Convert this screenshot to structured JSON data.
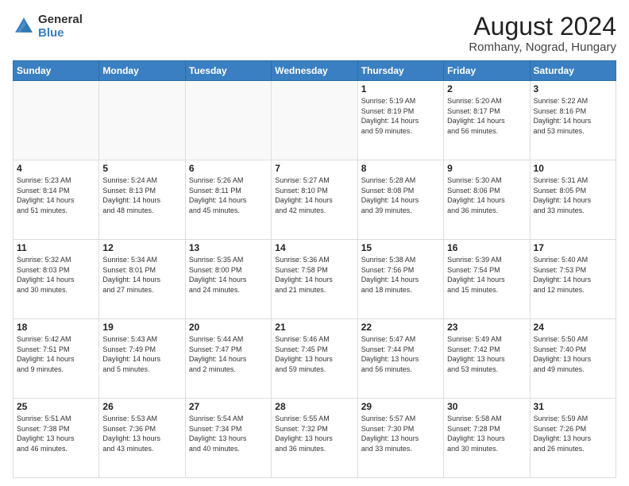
{
  "logo": {
    "line1": "General",
    "line2": "Blue"
  },
  "title": "August 2024",
  "subtitle": "Romhany, Nograd, Hungary",
  "weekdays": [
    "Sunday",
    "Monday",
    "Tuesday",
    "Wednesday",
    "Thursday",
    "Friday",
    "Saturday"
  ],
  "weeks": [
    [
      {
        "day": "",
        "info": ""
      },
      {
        "day": "",
        "info": ""
      },
      {
        "day": "",
        "info": ""
      },
      {
        "day": "",
        "info": ""
      },
      {
        "day": "1",
        "info": "Sunrise: 5:19 AM\nSunset: 8:19 PM\nDaylight: 14 hours\nand 59 minutes."
      },
      {
        "day": "2",
        "info": "Sunrise: 5:20 AM\nSunset: 8:17 PM\nDaylight: 14 hours\nand 56 minutes."
      },
      {
        "day": "3",
        "info": "Sunrise: 5:22 AM\nSunset: 8:16 PM\nDaylight: 14 hours\nand 53 minutes."
      }
    ],
    [
      {
        "day": "4",
        "info": "Sunrise: 5:23 AM\nSunset: 8:14 PM\nDaylight: 14 hours\nand 51 minutes."
      },
      {
        "day": "5",
        "info": "Sunrise: 5:24 AM\nSunset: 8:13 PM\nDaylight: 14 hours\nand 48 minutes."
      },
      {
        "day": "6",
        "info": "Sunrise: 5:26 AM\nSunset: 8:11 PM\nDaylight: 14 hours\nand 45 minutes."
      },
      {
        "day": "7",
        "info": "Sunrise: 5:27 AM\nSunset: 8:10 PM\nDaylight: 14 hours\nand 42 minutes."
      },
      {
        "day": "8",
        "info": "Sunrise: 5:28 AM\nSunset: 8:08 PM\nDaylight: 14 hours\nand 39 minutes."
      },
      {
        "day": "9",
        "info": "Sunrise: 5:30 AM\nSunset: 8:06 PM\nDaylight: 14 hours\nand 36 minutes."
      },
      {
        "day": "10",
        "info": "Sunrise: 5:31 AM\nSunset: 8:05 PM\nDaylight: 14 hours\nand 33 minutes."
      }
    ],
    [
      {
        "day": "11",
        "info": "Sunrise: 5:32 AM\nSunset: 8:03 PM\nDaylight: 14 hours\nand 30 minutes."
      },
      {
        "day": "12",
        "info": "Sunrise: 5:34 AM\nSunset: 8:01 PM\nDaylight: 14 hours\nand 27 minutes."
      },
      {
        "day": "13",
        "info": "Sunrise: 5:35 AM\nSunset: 8:00 PM\nDaylight: 14 hours\nand 24 minutes."
      },
      {
        "day": "14",
        "info": "Sunrise: 5:36 AM\nSunset: 7:58 PM\nDaylight: 14 hours\nand 21 minutes."
      },
      {
        "day": "15",
        "info": "Sunrise: 5:38 AM\nSunset: 7:56 PM\nDaylight: 14 hours\nand 18 minutes."
      },
      {
        "day": "16",
        "info": "Sunrise: 5:39 AM\nSunset: 7:54 PM\nDaylight: 14 hours\nand 15 minutes."
      },
      {
        "day": "17",
        "info": "Sunrise: 5:40 AM\nSunset: 7:53 PM\nDaylight: 14 hours\nand 12 minutes."
      }
    ],
    [
      {
        "day": "18",
        "info": "Sunrise: 5:42 AM\nSunset: 7:51 PM\nDaylight: 14 hours\nand 9 minutes."
      },
      {
        "day": "19",
        "info": "Sunrise: 5:43 AM\nSunset: 7:49 PM\nDaylight: 14 hours\nand 5 minutes."
      },
      {
        "day": "20",
        "info": "Sunrise: 5:44 AM\nSunset: 7:47 PM\nDaylight: 14 hours\nand 2 minutes."
      },
      {
        "day": "21",
        "info": "Sunrise: 5:46 AM\nSunset: 7:45 PM\nDaylight: 13 hours\nand 59 minutes."
      },
      {
        "day": "22",
        "info": "Sunrise: 5:47 AM\nSunset: 7:44 PM\nDaylight: 13 hours\nand 56 minutes."
      },
      {
        "day": "23",
        "info": "Sunrise: 5:49 AM\nSunset: 7:42 PM\nDaylight: 13 hours\nand 53 minutes."
      },
      {
        "day": "24",
        "info": "Sunrise: 5:50 AM\nSunset: 7:40 PM\nDaylight: 13 hours\nand 49 minutes."
      }
    ],
    [
      {
        "day": "25",
        "info": "Sunrise: 5:51 AM\nSunset: 7:38 PM\nDaylight: 13 hours\nand 46 minutes."
      },
      {
        "day": "26",
        "info": "Sunrise: 5:53 AM\nSunset: 7:36 PM\nDaylight: 13 hours\nand 43 minutes."
      },
      {
        "day": "27",
        "info": "Sunrise: 5:54 AM\nSunset: 7:34 PM\nDaylight: 13 hours\nand 40 minutes."
      },
      {
        "day": "28",
        "info": "Sunrise: 5:55 AM\nSunset: 7:32 PM\nDaylight: 13 hours\nand 36 minutes."
      },
      {
        "day": "29",
        "info": "Sunrise: 5:57 AM\nSunset: 7:30 PM\nDaylight: 13 hours\nand 33 minutes."
      },
      {
        "day": "30",
        "info": "Sunrise: 5:58 AM\nSunset: 7:28 PM\nDaylight: 13 hours\nand 30 minutes."
      },
      {
        "day": "31",
        "info": "Sunrise: 5:59 AM\nSunset: 7:26 PM\nDaylight: 13 hours\nand 26 minutes."
      }
    ]
  ]
}
